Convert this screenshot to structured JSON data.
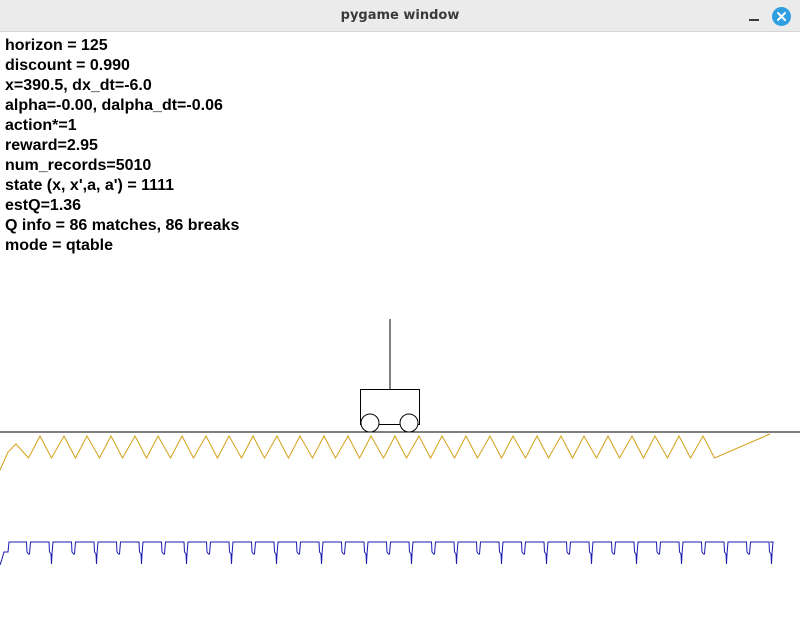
{
  "window": {
    "title": "pygame window"
  },
  "info_lines": [
    "horizon = 125",
    "discount = 0.990",
    "x=390.5, dx_dt=-6.0",
    "alpha=-0.00, dalpha_dt=-0.06",
    "action*=1",
    "reward=2.95",
    "num_records=5010",
    "state (x, x',a, a') = 1111",
    "estQ=1.36",
    "Q info = 86 matches, 86 breaks",
    "mode = qtable"
  ],
  "icons": {
    "minimize": "minimize-icon",
    "close": "close-icon"
  },
  "colors": {
    "close_button": "#2f9fe0",
    "reward_trace": "#d4a017",
    "action_trace": "#1a1ab0",
    "track": "#000000"
  },
  "scene": {
    "cart_x": 390.5,
    "pole_angle": -0.0
  }
}
